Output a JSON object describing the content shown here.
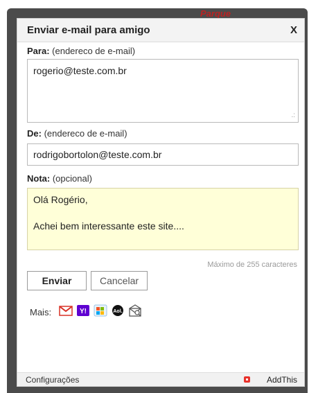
{
  "background": {
    "partial_text": "Parque"
  },
  "dialog": {
    "title": "Enviar e-mail para amigo",
    "close_label": "X"
  },
  "to": {
    "label_bold": "Para:",
    "label_hint": "(endereco de e-mail)",
    "value": "rogerio@teste.com.br"
  },
  "from": {
    "label_bold": "De:",
    "label_hint": "(endereco de e-mail)",
    "value": "rodrigobortolon@teste.com.br"
  },
  "note": {
    "label_bold": "Nota:",
    "label_hint": "(opcional)",
    "line1": "Olá Rogério,",
    "line2": "Achei bem interessante este site....",
    "max_hint": "Máximo de 255 caracteres"
  },
  "buttons": {
    "send": "Enviar",
    "cancel": "Cancelar"
  },
  "share": {
    "more_label": "Mais:",
    "services": [
      {
        "name": "gmail-icon",
        "color": "#d93025"
      },
      {
        "name": "yahoo-icon",
        "color": "#5f01d1"
      },
      {
        "name": "windows-live-icon",
        "color": "#1b9ad8"
      },
      {
        "name": "aol-icon",
        "color": "#111111"
      },
      {
        "name": "email-client-icon",
        "color": "#555555"
      }
    ]
  },
  "footer": {
    "settings_label": "Configurações",
    "brand_label": "AddThis"
  },
  "colors": {
    "note_bg": "#ffffd8",
    "frame": "#4b4b4b",
    "addthis_brand": "#e8322b"
  }
}
